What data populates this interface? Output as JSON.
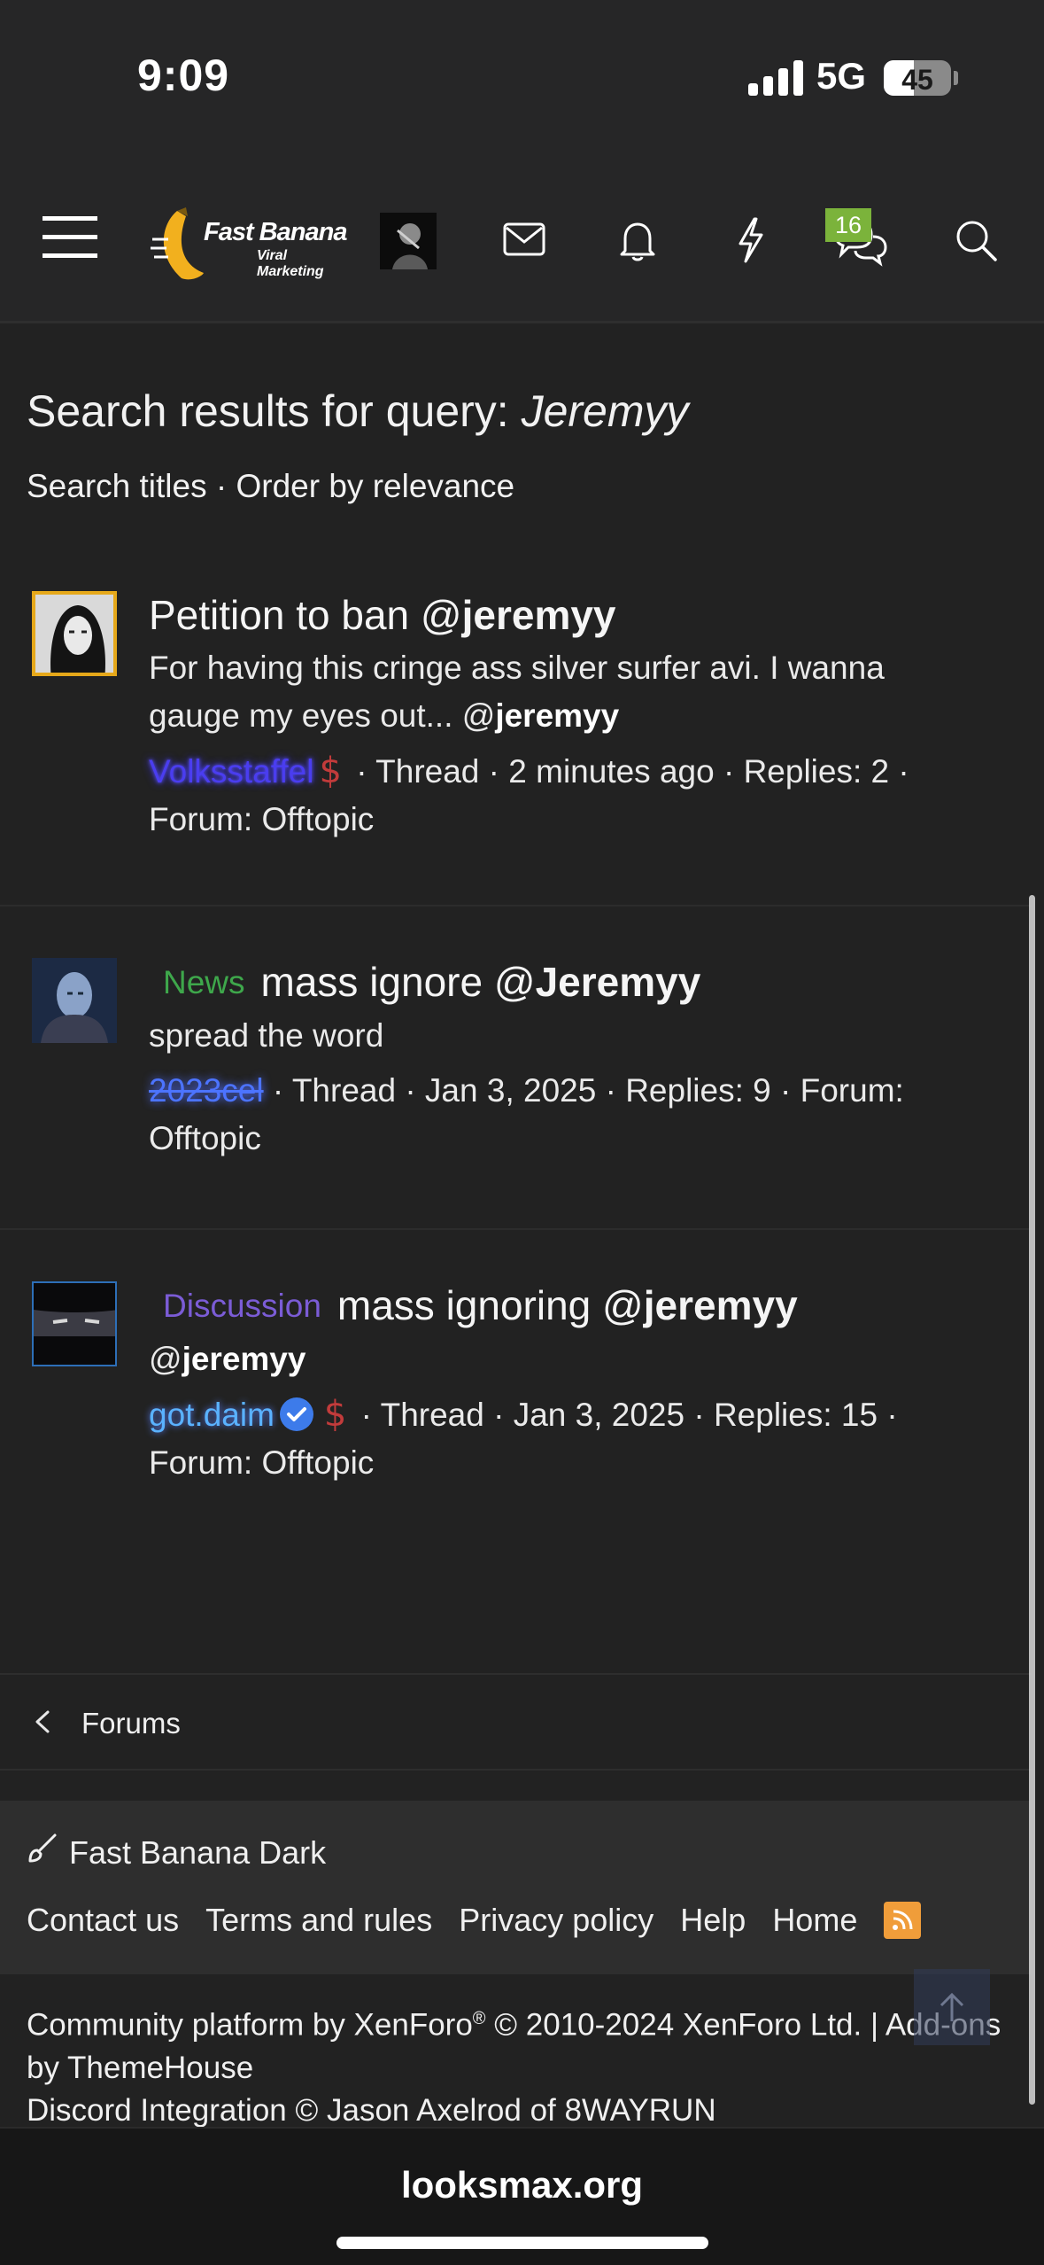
{
  "status_bar": {
    "time": "9:09",
    "network": "5G",
    "battery": "45",
    "battery_level": 0.45
  },
  "header": {
    "logo_title": "Fast Banana",
    "logo_subtitle": "Viral Marketing",
    "conversations_badge": "16",
    "icons": [
      "menu-icon",
      "envelope-icon",
      "bell-icon",
      "lightning-icon",
      "chat-bubbles-icon",
      "search-icon"
    ]
  },
  "page": {
    "title_prefix": "Search results for query: ",
    "title_query": "Jeremyy",
    "subnav_titles": "Search titles",
    "subnav_sep": " · ",
    "subnav_order": "Order by relevance"
  },
  "results": [
    {
      "prefix": "",
      "title_pre": "Petition to ban @",
      "title_bold": "jeremyy",
      "snippet_pre": "For having this cringe ass silver surfer avi. I wanna gauge my eyes out... @",
      "snippet_bold": "jeremyy",
      "author": "Volksstaffel",
      "meta": " · Thread · 2 minutes ago · Replies: 2 · Forum: Offtopic"
    },
    {
      "prefix": "News",
      "prefix_color": "#3ea74b",
      "title_pre": "mass ignore @",
      "title_bold": "Jeremyy",
      "snippet_pre": "spread the word",
      "snippet_bold": "",
      "author": "2023cel",
      "meta": " · Thread · Jan 3, 2025 · Replies: 9 · Forum: Offtopic"
    },
    {
      "prefix": "Discussion",
      "prefix_color": "#7b5cd6",
      "title_pre": "mass ignoring @",
      "title_bold": "jeremyy",
      "snippet_pre": "@",
      "snippet_bold": "jeremyy",
      "author": "got.daim",
      "meta": " · Thread · Jan 3, 2025 · Replies: 15 · Forum: Offtopic"
    }
  ],
  "breadcrumb": {
    "label": "Forums"
  },
  "footer": {
    "style_name": "Fast Banana Dark",
    "links": [
      "Contact us",
      "Terms and rules",
      "Privacy policy",
      "Help",
      "Home"
    ],
    "copyright_line1_a": "Community platform by XenForo",
    "copyright_reg": "®",
    "copyright_line1_b": " © 2010-2024 XenForo Ltd. | Add-ons by ThemeHouse",
    "copyright_line2": "Discord Integration © Jason Axelrod of 8WAYRUN"
  },
  "browser": {
    "url": "looksmax.org"
  },
  "colors": {
    "background": "#222222",
    "header": "#262627",
    "badge": "#7bb33b",
    "rss": "#f09d3a"
  }
}
